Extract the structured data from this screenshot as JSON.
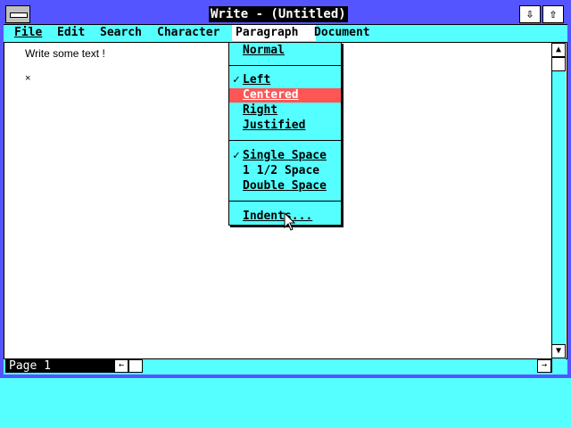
{
  "window": {
    "title": "Write - (Untitled)",
    "min_icon": "down-arrow-icon",
    "max_icon": "up-arrow-icon"
  },
  "menubar": {
    "items": [
      {
        "label": "File"
      },
      {
        "label": "Edit"
      },
      {
        "label": "Search"
      },
      {
        "label": "Character"
      },
      {
        "label": "Paragraph",
        "active": true
      },
      {
        "label": "Document"
      }
    ]
  },
  "paragraph_menu": {
    "items": [
      {
        "label": "Normal",
        "checked": false
      },
      {
        "label": "Left",
        "checked": true
      },
      {
        "label": "Centered",
        "checked": false,
        "highlighted": true
      },
      {
        "label": "Right",
        "checked": false
      },
      {
        "label": "Justified",
        "checked": false
      },
      {
        "label": "Single Space",
        "checked": true
      },
      {
        "label": "1 1/2 Space",
        "checked": false
      },
      {
        "label": "Double Space",
        "checked": false
      },
      {
        "label": "Indents...",
        "checked": false
      }
    ],
    "check_glyph": "✓"
  },
  "document": {
    "text": "Write some text !",
    "end_mark": "×"
  },
  "status": {
    "page_label": "Page 1"
  },
  "scroll": {
    "up_glyph": "▲",
    "down_glyph": "▼",
    "left_glyph": "←",
    "right_glyph": "→"
  },
  "colors": {
    "title_bar": "#5555ff",
    "menu_bg": "#55ffff",
    "highlight": "#ff5555",
    "desktop": "#55ffff"
  }
}
